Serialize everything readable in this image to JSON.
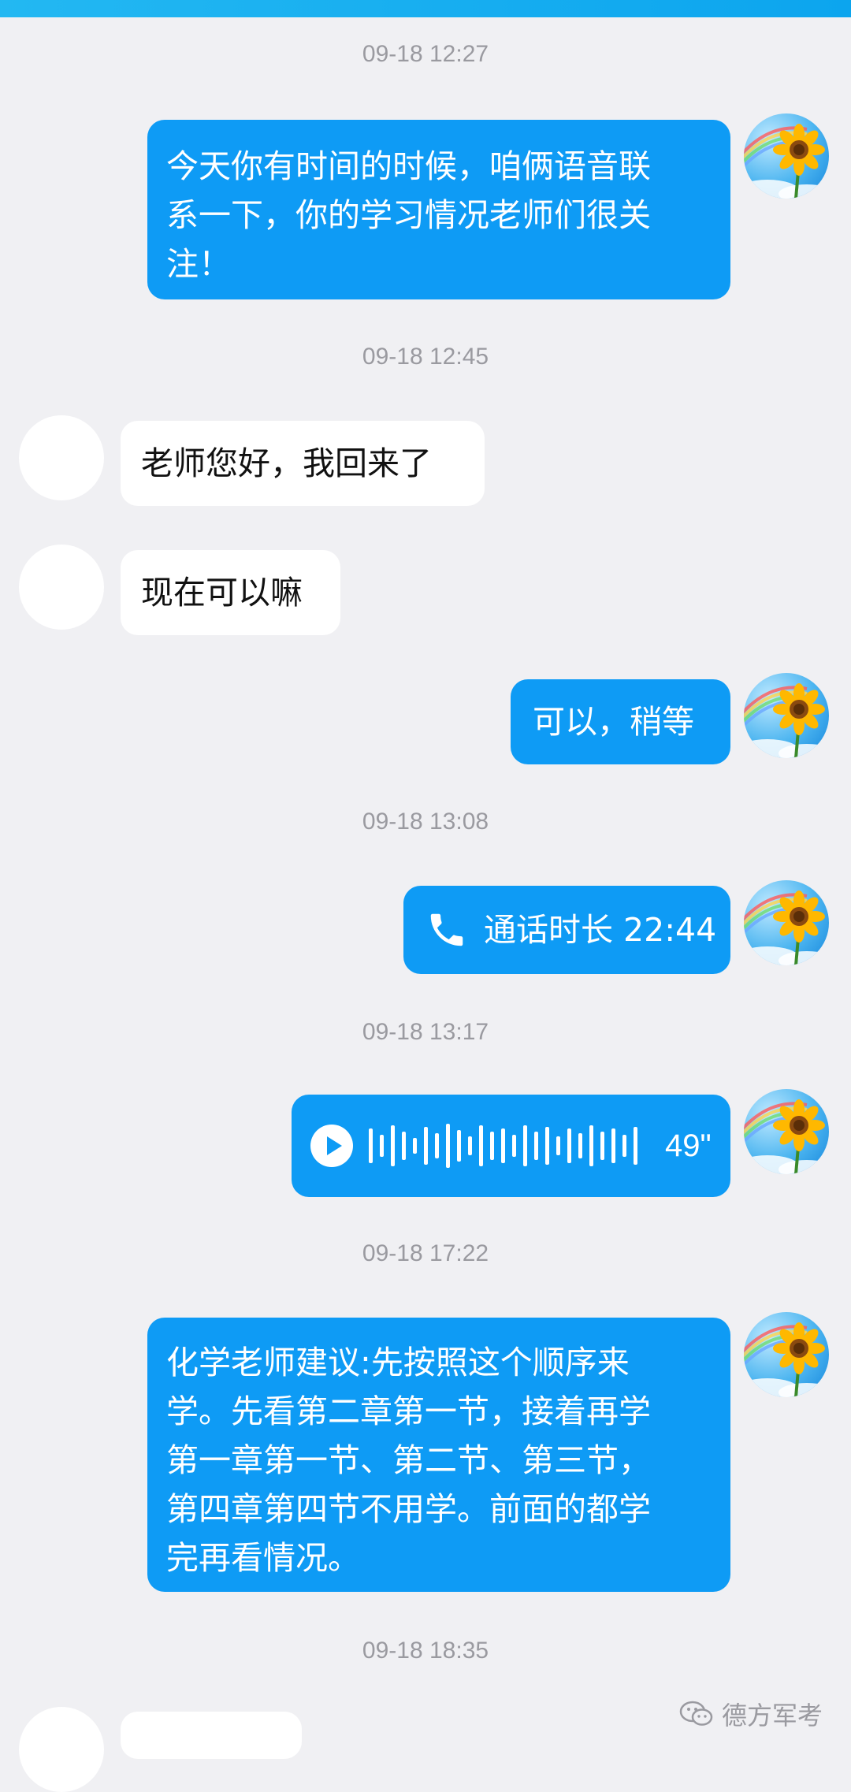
{
  "messages": [
    {
      "timestamp": "09-18 12:27",
      "direction": "out",
      "type": "text",
      "lines": [
        "今天你有时间的时候，咱俩语音联",
        "系一下，你的学习情况老师们很关",
        "注！"
      ]
    },
    {
      "timestamp": "09-18 12:45",
      "direction": "in",
      "type": "text",
      "lines": [
        "老师您好，我回来了"
      ]
    },
    {
      "direction": "in",
      "type": "text",
      "lines": [
        "现在可以嘛"
      ]
    },
    {
      "direction": "out",
      "type": "text",
      "lines": [
        "可以，稍等"
      ]
    },
    {
      "timestamp": "09-18 13:08",
      "direction": "out",
      "type": "call",
      "icon": "phone-icon",
      "label": "通话时长 22:44"
    },
    {
      "timestamp": "09-18 13:17",
      "direction": "out",
      "type": "voice",
      "icon": "play-icon",
      "duration": "49\""
    },
    {
      "timestamp": "09-18 17:22",
      "direction": "out",
      "type": "text",
      "lines": [
        "化学老师建议:先按照这个顺序来",
        "学。先看第二章第一节，接着再学",
        "第一章第一节、第二节、第三节，",
        "第四章第四节不用学。前面的都学",
        "完再看情况。"
      ]
    },
    {
      "timestamp": "09-18 18:35"
    }
  ],
  "watermark": {
    "icon": "wechat-icon",
    "text": "德方军考"
  },
  "colors": {
    "outgoing_bubble": "#0e9bf5",
    "incoming_bubble": "#ffffff",
    "background": "#f0f0f3",
    "timestamp": "#9a9aa0",
    "top_bar": "#1aaef0"
  }
}
